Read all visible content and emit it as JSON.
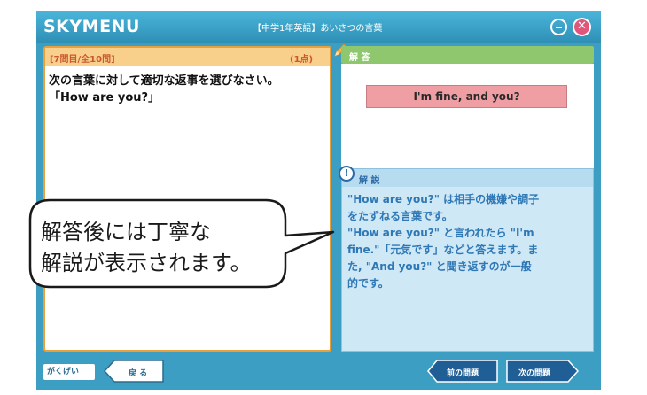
{
  "window": {
    "app_name": "SKYMENU",
    "title": "【中学1年英語】あいさつの言葉",
    "close_glyph": "✕"
  },
  "question": {
    "count": "[7問目/全10問]",
    "points": "(1点)",
    "lines": [
      "次の言葉に対して適切な返事を選びなさい。",
      "「How are you?」"
    ]
  },
  "answer": {
    "label": "解 答",
    "text": "I'm fine, and you?"
  },
  "explanation": {
    "label": "解 説",
    "icon_glyph": "!",
    "lines": [
      "\"How are you?\" は相手の機嫌や調子",
      "をたずねる言葉です。",
      "\"How are you?\" と言われたら \"I'm",
      "fine.\"「元気です」などと答えます。ま",
      "た, \"And you?\" と聞き返すのが一般",
      "的です。"
    ]
  },
  "footer": {
    "brand": "がくげい",
    "back_label": "戻 る",
    "prev_label": "前の問題",
    "next_label": "次の問題"
  },
  "callout": {
    "lines": [
      "解答後には丁寧な",
      "解説が表示されます。"
    ]
  },
  "colors": {
    "titlebar": "#3b9ec2",
    "question_border": "#e9a03a",
    "answer_header": "#8ec76e",
    "answer_box": "#ef9ea4",
    "explanation_bg": "#cfe8f6",
    "explanation_text": "#2f78b6"
  }
}
